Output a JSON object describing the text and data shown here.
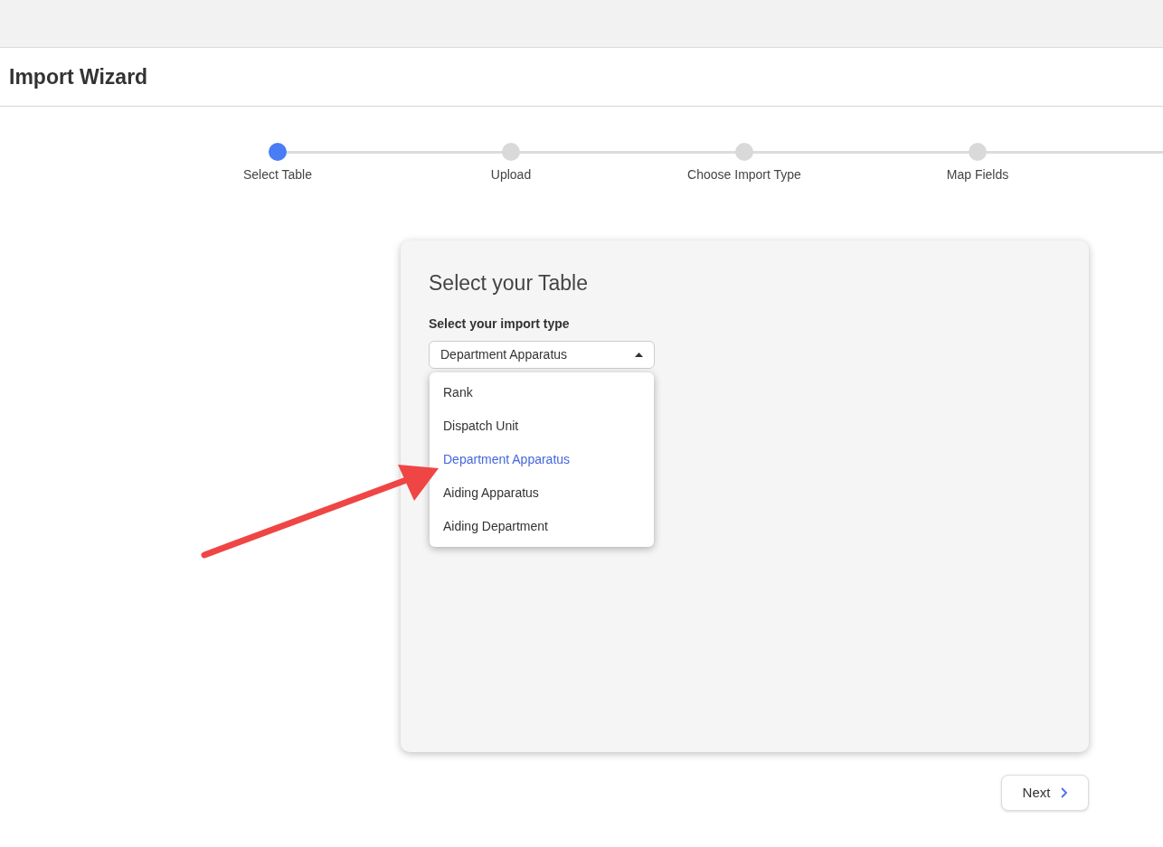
{
  "page": {
    "title": "Import Wizard"
  },
  "steps": [
    {
      "label": "Select Table",
      "selected": true
    },
    {
      "label": "Upload",
      "selected": false
    },
    {
      "label": "Choose Import Type",
      "selected": false
    },
    {
      "label": "Map Fields",
      "selected": false
    }
  ],
  "card": {
    "title": "Select your Table",
    "field_label": "Select your import type",
    "value": "Department Apparatus",
    "expanded": true,
    "options": [
      {
        "label": "Rank",
        "selected": false
      },
      {
        "label": "Dispatch Unit",
        "selected": false
      },
      {
        "label": "Department Apparatus",
        "selected": true
      },
      {
        "label": "Aiding Apparatus",
        "selected": false
      },
      {
        "label": "Aiding Department",
        "selected": false
      }
    ]
  },
  "next_button": {
    "label": "Next"
  }
}
